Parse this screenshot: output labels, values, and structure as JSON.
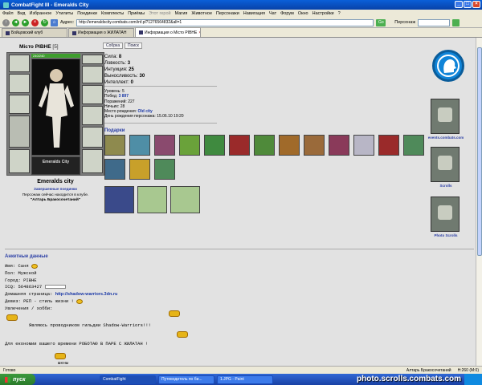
{
  "window": {
    "title": "CombatFight III - Emeralds City"
  },
  "menu": [
    "Файл",
    "Вид",
    "Избранное",
    "Утилиты",
    "Поединки",
    "Комплекты",
    "Приёмы",
    "Этот герой",
    "Магия",
    "Животное",
    "Персонажи",
    "Навигация",
    "Чат",
    "Форум",
    "Окно",
    "Настройки",
    "?"
  ],
  "address": {
    "label": "Адрес:",
    "url": "http://emeraldscity.combats.com/inf.pl?1276564832&all=1",
    "go": "Go",
    "search_label": "Персонаж"
  },
  "tabs": [
    {
      "label": "Бойцовский клуб"
    },
    {
      "label": "Информация о ЖИЛАТАН"
    },
    {
      "label": "Информация о Місто РІВНЕ"
    }
  ],
  "character": {
    "name": "Місто РІВНЕ",
    "level": "[5]",
    "hp": "240/240",
    "city": "Emeralds city",
    "status": "Завершенные поединки",
    "location_line": "Персонаж сейчас находится в клубе.",
    "location_room": "\"Алтарь Бракосочетаний\"",
    "logo_text": "Emeralds City"
  },
  "buttons": {
    "collection": "Собрка",
    "search": "Поиск"
  },
  "stats": [
    {
      "label": "Сила:",
      "value": "8"
    },
    {
      "label": "Ловкость:",
      "value": "3"
    },
    {
      "label": "Интуиция:",
      "value": "25"
    },
    {
      "label": "Выносливость:",
      "value": "30"
    },
    {
      "label": "Интеллект:",
      "value": "0"
    }
  ],
  "info": {
    "level_label": "Уровень:",
    "level": "5",
    "wins_label": "Побед:",
    "wins": "3 897",
    "losses_label": "Поражений:",
    "losses": "227",
    "draws_label": "Ничьих:",
    "draws": "28",
    "birthplace_label": "Место рождения:",
    "birthplace": "Old city",
    "birthday_label": "День рождения персонажа:",
    "birthday": "15.06.10 19:20"
  },
  "gifts_title": "Подарки",
  "side": [
    {
      "label": "events.combats.com"
    },
    {
      "label": "Scrolls"
    },
    {
      "label": "Photo Scrolls"
    }
  ],
  "questionnaire": {
    "title": "Анкетные данные",
    "name": "Имя: Саня",
    "sex": "Пол: Мужской",
    "city": "Город: РІВНЕ",
    "icq": "ICQ: 564863427",
    "homepage_label": "Домашняя страница:",
    "homepage": "http://shadow-warriors.3dn.ru",
    "motto": "Девиз: РЕП - стиль жизни !",
    "hobby": "Увлечения / хобби:",
    "line1": "Являюсь проводником гильдии Shadow-Warriors!!!",
    "line2": "Для економии вашего времени РОБОТАЮ В ПАРЕ С ЖИЛАТАН !",
    "line3": "шкны"
  },
  "status": {
    "left": "Готово",
    "room": "Алтарь Бракосочетаний",
    "hp": "H:260 (M:0)"
  },
  "taskbar": {
    "start": "пуск",
    "items": [
      "CombatFight",
      "Путеводитель по би...",
      "1.JPG - Paint"
    ]
  },
  "watermark": "photo.scrolls.combats.com",
  "colors": {
    "accent": "#2a3ea5",
    "titlebar": "#0A5FD8",
    "page_bg": "#E2E2E2"
  }
}
